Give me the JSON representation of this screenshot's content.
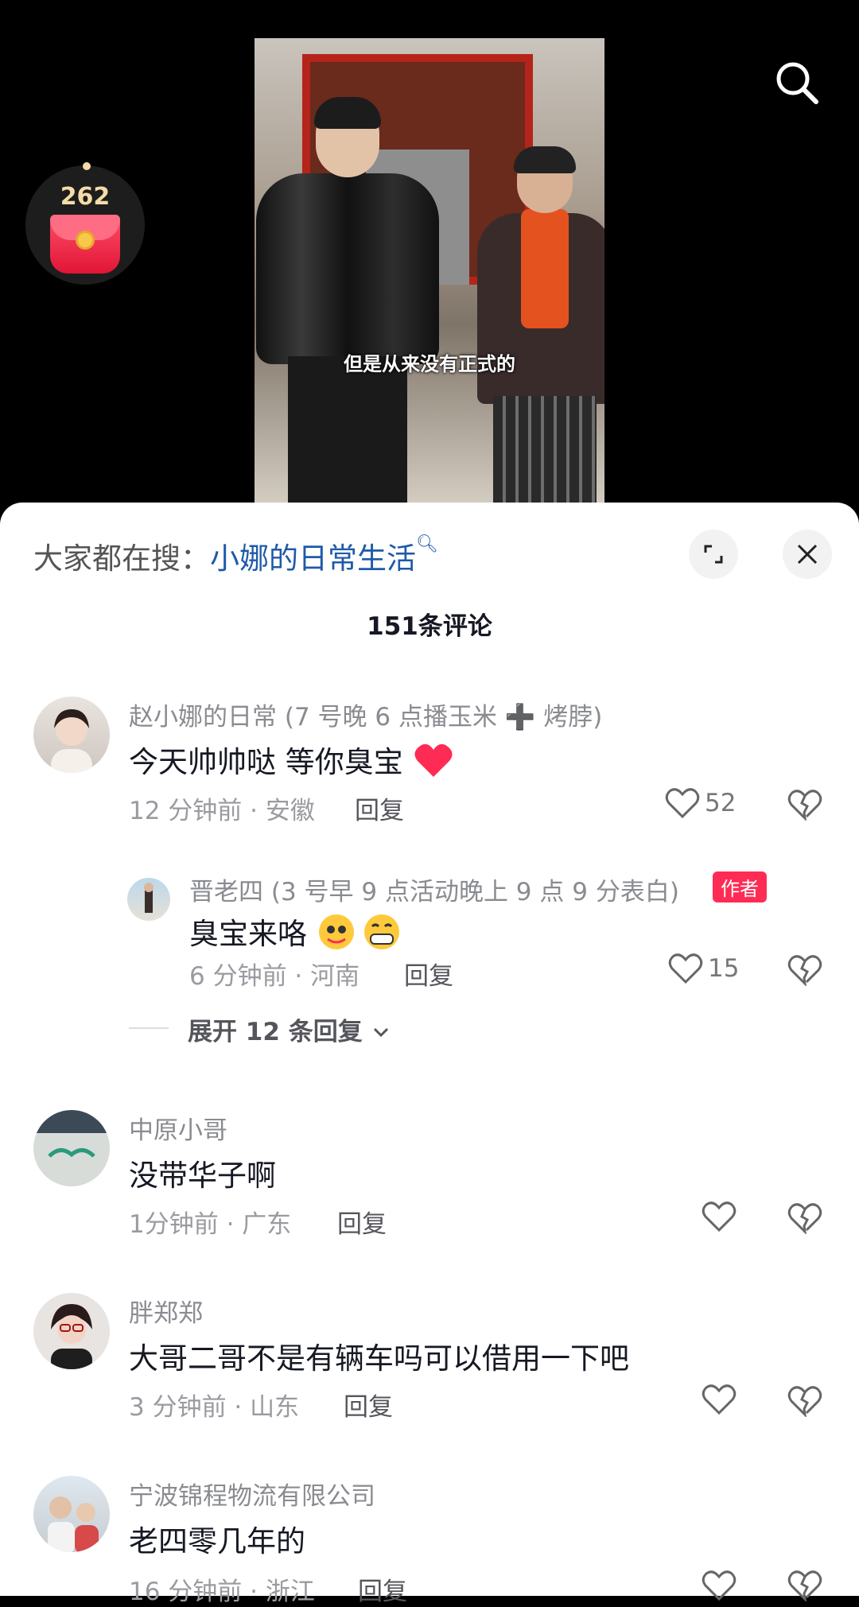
{
  "video": {
    "subtitle": "但是从来没有正式的"
  },
  "red_packet": {
    "count": "262"
  },
  "sheet": {
    "search_prefix": "大家都在搜：",
    "search_query": "小娜的日常生活",
    "comment_count": "151条评论"
  },
  "comments": [
    {
      "name": "赵小娜的日常 (7 号晚 6 点播玉米 ➕ 烤脖)",
      "text": "今天帅帅哒 等你臭宝",
      "meta": "12 分钟前 · 安徽",
      "reply_label": "回复",
      "likes": "52",
      "reply": {
        "name": "晋老四 (3 号早 9 点活动晚上 9 点 9 分表白)",
        "badge": "作者",
        "text": "臭宝来咯",
        "meta": "6 分钟前 · 河南",
        "reply_label": "回复",
        "likes": "15"
      },
      "expand_label": "展开 12 条回复"
    },
    {
      "name": "中原小哥",
      "text": "没带华子啊",
      "meta": "1分钟前 · 广东",
      "reply_label": "回复"
    },
    {
      "name": "胖郑郑",
      "text": "大哥二哥不是有辆车吗可以借用一下吧",
      "meta": "3 分钟前 · 山东",
      "reply_label": "回复"
    },
    {
      "name": "宁波锦程物流有限公司",
      "text": "老四零几年的",
      "meta": "16 分钟前 · 浙江",
      "reply_label": "回复"
    }
  ],
  "colors": {
    "link": "#1f5aa8",
    "author_badge": "#fe2c55",
    "heart": "#fe2c55"
  }
}
